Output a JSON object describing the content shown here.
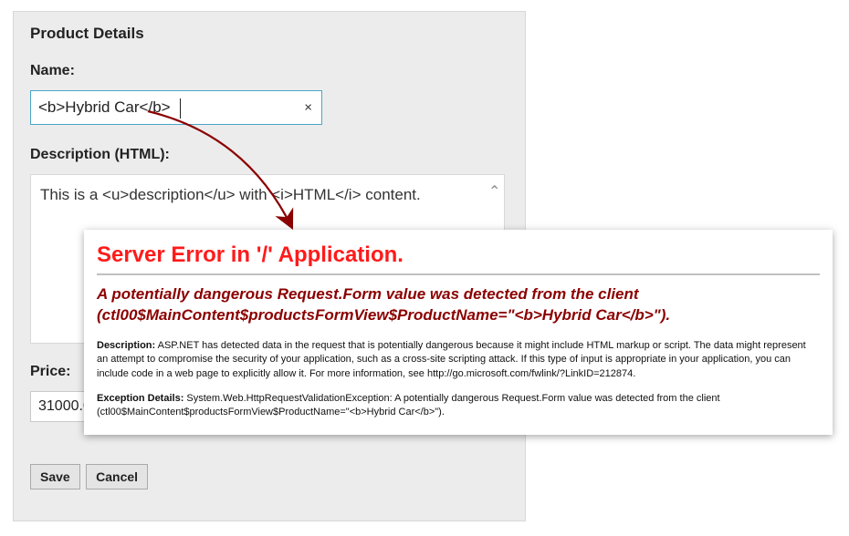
{
  "panel": {
    "title": "Product Details",
    "name_label": "Name:",
    "name_value": "<b>Hybrid Car</b>",
    "clear_glyph": "×",
    "desc_label": "Description (HTML):",
    "desc_value": "This is a <u>description</u> with <i>HTML</i> content.",
    "scroll_glyph": "⌃",
    "price_label": "Price:",
    "price_value": "31000.0",
    "save_label": "Save",
    "cancel_label": "Cancel"
  },
  "error": {
    "title": "Server Error in '/' Application.",
    "subheading": "A potentially dangerous Request.Form value was detected from the client (ctl00$MainContent$productsFormView$ProductName=\"<b>Hybrid Car</b>\").",
    "desc_label": "Description:",
    "desc_text": " ASP.NET has detected data in the request that is potentially dangerous because it might include HTML markup or script. The data might represent an attempt to compromise the security of your application, such as a cross-site scripting attack. If this type of input is appropriate in your application, you can include code in a web page to explicitly allow it. For more information, see http://go.microsoft.com/fwlink/?LinkID=212874.",
    "exc_label": "Exception Details:",
    "exc_text": " System.Web.HttpRequestValidationException: A potentially dangerous Request.Form value was detected from the client (ctl00$MainContent$productsFormView$ProductName=\"<b>Hybrid Car</b>\")."
  }
}
